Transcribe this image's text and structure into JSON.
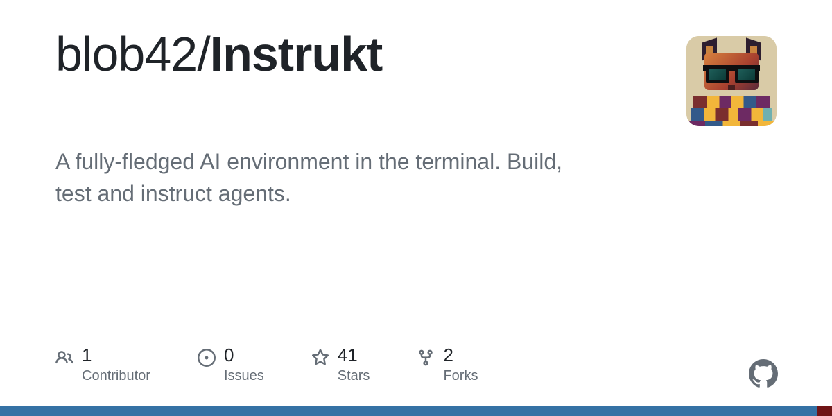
{
  "repo": {
    "owner": "blob42",
    "separator": "/",
    "name": "Instrukt",
    "description": "A fully-fledged AI environment in the terminal. Build, test and instruct agents."
  },
  "stats": {
    "contributors": {
      "value": "1",
      "label": "Contributor"
    },
    "issues": {
      "value": "0",
      "label": "Issues"
    },
    "stars": {
      "value": "41",
      "label": "Stars"
    },
    "forks": {
      "value": "2",
      "label": "Forks"
    }
  },
  "language_bar": [
    {
      "color": "#3572A5",
      "pct": 98.2
    },
    {
      "color": "#701516",
      "pct": 1.8
    }
  ]
}
